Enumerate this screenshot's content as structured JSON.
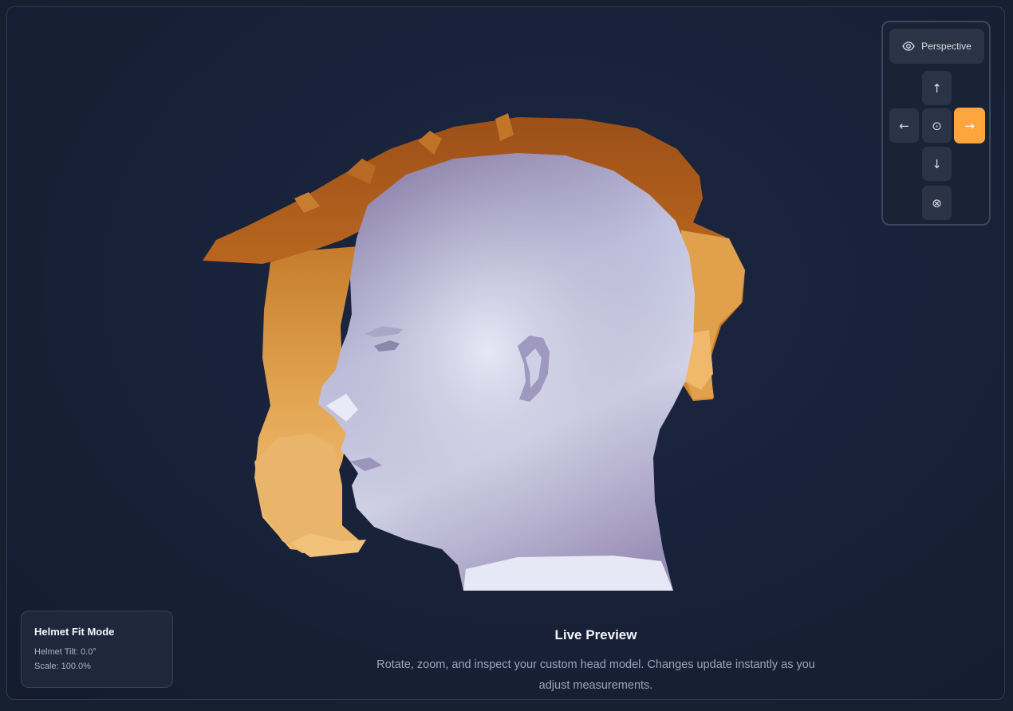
{
  "viewer": {
    "view_mode_label": "Perspective",
    "view_mode_icon": "eye-icon",
    "nav": {
      "up": "↑",
      "left": "←",
      "center": "⊙",
      "right": "→",
      "down": "↓",
      "reset": "⊗"
    },
    "active_direction": "right",
    "colors": {
      "accent": "#ffa53d",
      "helmet": "#d98a2e",
      "head": "#b8bcd8",
      "background": "#172031"
    }
  },
  "info_card": {
    "title": "Helmet Fit Mode",
    "tilt": "Helmet Tilt: 0.0°",
    "scale": "Scale: 100.0%"
  },
  "caption": {
    "title": "Live Preview",
    "text": "Rotate, zoom, and inspect your custom head model. Changes update instantly as you adjust measurements."
  }
}
